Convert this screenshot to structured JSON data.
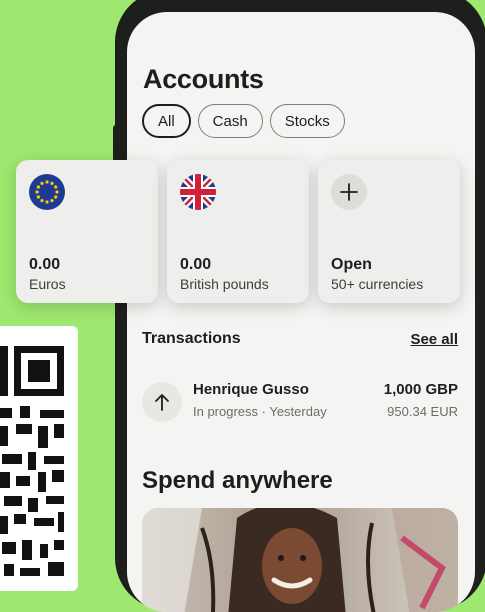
{
  "page": {
    "title": "Accounts"
  },
  "filters": [
    {
      "label": "All",
      "active": true
    },
    {
      "label": "Cash",
      "active": false
    },
    {
      "label": "Stocks",
      "active": false
    }
  ],
  "accounts": [
    {
      "flag": "eu-flag-icon",
      "amount": "0.00",
      "label": "Euros"
    },
    {
      "flag": "uk-flag-icon",
      "amount": "0.00",
      "label": "British pounds"
    },
    {
      "flag": "plus-icon",
      "amount": "Open",
      "label": "50+ currencies"
    }
  ],
  "transactions": {
    "title": "Transactions",
    "see_all": "See all",
    "items": [
      {
        "icon": "arrow-up-icon",
        "name": "Henrique Gusso",
        "status": "In progress · Yesterday",
        "amount": "1,000 GBP",
        "converted": "950.34 EUR"
      }
    ]
  },
  "spend": {
    "title": "Spend anywhere"
  },
  "colors": {
    "background": "#9fe870",
    "text": "#1c1f1b",
    "screen": "#f4f5f2"
  }
}
